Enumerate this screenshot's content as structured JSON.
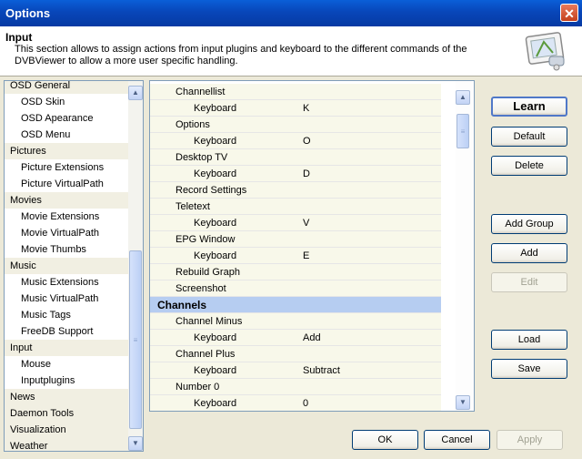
{
  "window": {
    "title": "Options",
    "close_label": "✕"
  },
  "header": {
    "title": "Input",
    "description": "This section allows to assign actions from input plugins and keyboard to the different commands of the DVBViewer to allow a more user specific handling."
  },
  "nav": {
    "items": [
      {
        "label": "OSD General",
        "kind": "cat"
      },
      {
        "label": "OSD Skin",
        "kind": "sub"
      },
      {
        "label": "OSD Apearance",
        "kind": "sub"
      },
      {
        "label": "OSD Menu",
        "kind": "sub"
      },
      {
        "label": "Pictures",
        "kind": "cat"
      },
      {
        "label": "Picture Extensions",
        "kind": "sub"
      },
      {
        "label": "Picture VirtualPath",
        "kind": "sub"
      },
      {
        "label": "Movies",
        "kind": "cat"
      },
      {
        "label": "Movie Extensions",
        "kind": "sub"
      },
      {
        "label": "Movie VirtualPath",
        "kind": "sub"
      },
      {
        "label": "Movie Thumbs",
        "kind": "sub"
      },
      {
        "label": "Music",
        "kind": "cat"
      },
      {
        "label": "Music Extensions",
        "kind": "sub"
      },
      {
        "label": "Music VirtualPath",
        "kind": "sub"
      },
      {
        "label": "Music Tags",
        "kind": "sub"
      },
      {
        "label": "FreeDB Support",
        "kind": "sub"
      },
      {
        "label": "Input",
        "kind": "cat",
        "selected": true
      },
      {
        "label": "Mouse",
        "kind": "sub"
      },
      {
        "label": "Inputplugins",
        "kind": "sub"
      },
      {
        "label": "News",
        "kind": "cat"
      },
      {
        "label": "Daemon Tools",
        "kind": "cat"
      },
      {
        "label": "Visualization",
        "kind": "cat"
      },
      {
        "label": "Weather",
        "kind": "cat"
      }
    ]
  },
  "bindings": {
    "rows": [
      {
        "kind": "cmd",
        "label": "Channellist"
      },
      {
        "kind": "bind",
        "type": "Keyboard",
        "key": "K"
      },
      {
        "kind": "cmd",
        "label": "Options"
      },
      {
        "kind": "bind",
        "type": "Keyboard",
        "key": "O"
      },
      {
        "kind": "cmd",
        "label": "Desktop TV"
      },
      {
        "kind": "bind",
        "type": "Keyboard",
        "key": "D"
      },
      {
        "kind": "cmd",
        "label": "Record Settings"
      },
      {
        "kind": "cmd",
        "label": "Teletext"
      },
      {
        "kind": "bind",
        "type": "Keyboard",
        "key": "V"
      },
      {
        "kind": "cmd",
        "label": "EPG Window"
      },
      {
        "kind": "bind",
        "type": "Keyboard",
        "key": "E"
      },
      {
        "kind": "cmd",
        "label": "Rebuild Graph"
      },
      {
        "kind": "cmd",
        "label": "Screenshot"
      },
      {
        "kind": "group",
        "label": "Channels"
      },
      {
        "kind": "cmd",
        "label": "Channel Minus"
      },
      {
        "kind": "bind",
        "type": "Keyboard",
        "key": "Add"
      },
      {
        "kind": "cmd",
        "label": "Channel Plus"
      },
      {
        "kind": "bind",
        "type": "Keyboard",
        "key": "Subtract"
      },
      {
        "kind": "cmd",
        "label": "Number 0"
      },
      {
        "kind": "bind",
        "type": "Keyboard",
        "key": "0"
      }
    ]
  },
  "buttons": {
    "learn": "Learn",
    "default": "Default",
    "delete": "Delete",
    "add_group": "Add Group",
    "add": "Add",
    "edit": "Edit",
    "load": "Load",
    "save": "Save",
    "ok": "OK",
    "cancel": "Cancel",
    "apply": "Apply"
  },
  "icons": {
    "scroll_up": "▲",
    "scroll_down": "▼",
    "grip": "≡"
  }
}
